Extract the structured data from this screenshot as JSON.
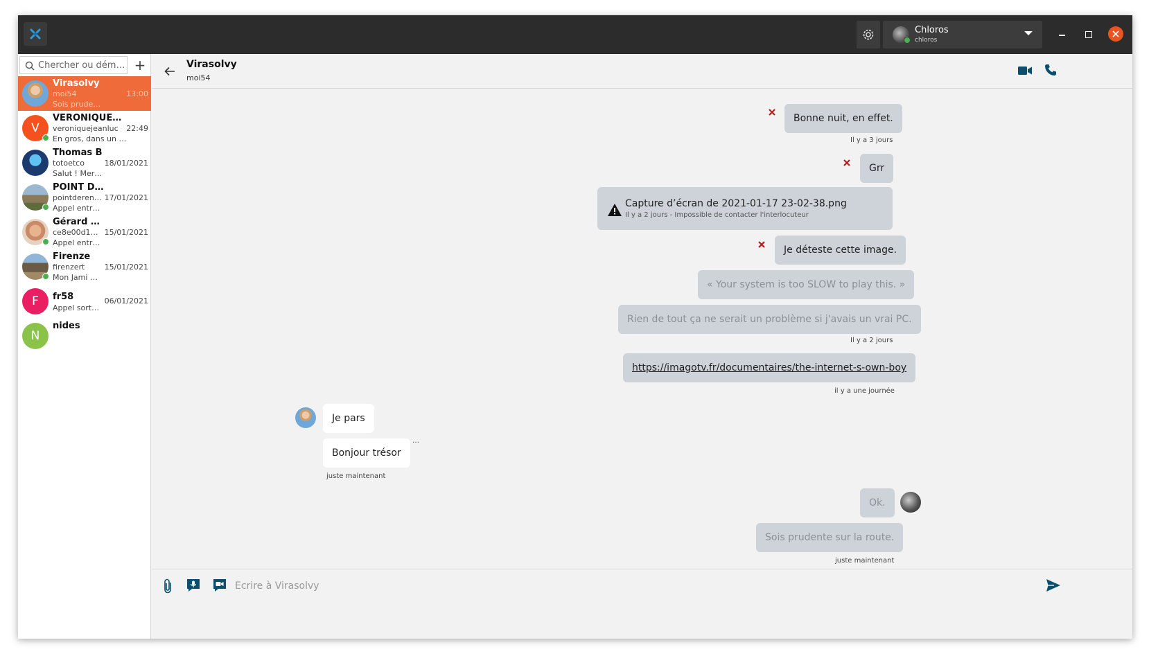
{
  "titlebar": {
    "account_name": "Chloros",
    "account_id": "chloros",
    "colors": {
      "bar": "#2c2c2c",
      "close": "#e95420",
      "accent": "#f06b3a",
      "online": "#4caf50"
    }
  },
  "sidebar": {
    "search_placeholder": "Chercher ou dém…",
    "add_label": "+",
    "conversations": [
      {
        "name": "Virasolvy",
        "id": "moi54",
        "time": "13:00",
        "preview": "Sois prudente sur…"
      },
      {
        "name": "VERONIQUE…",
        "id": "veroniquejeanluc",
        "time": "22:49",
        "preview": "En gros, dans un t…",
        "initial": "V"
      },
      {
        "name": "Thomas B",
        "id": "totoetco",
        "time": "18/01/2021",
        "preview": "Salut ! Mer…"
      },
      {
        "name": "POINT D…",
        "id": "pointderen…",
        "time": "17/01/2021",
        "preview": "Appel entr…"
      },
      {
        "name": "Gérard …",
        "id": "ce8e00d16…",
        "time": "15/01/2021",
        "preview": "Appel entr…"
      },
      {
        "name": "Firenze",
        "id": "firenzert",
        "time": "15/01/2021",
        "preview": "Mon Jami …"
      },
      {
        "name": "fr58",
        "id": "Appel sorta…",
        "time": "06/01/2021",
        "initial": "F"
      },
      {
        "name": "nides",
        "initial": "N"
      }
    ]
  },
  "chat": {
    "peer_name": "Virasolvy",
    "peer_id": "moi54",
    "messages": {
      "m1": "Bonne nuit, en effet.",
      "ts1": "Il y a 3 jours",
      "m2": "Grr",
      "file_name": "Capture d’écran de 2021-01-17 23-02-38.png",
      "file_status": "Il y a 2 jours - Impossible de contacter l'interlocuteur",
      "m3": "Je déteste cette image.",
      "m4": "« Your system is too SLOW to play this. »",
      "m5": "Rien de tout ça ne serait un problème si j'avais un vrai PC.",
      "ts2": "Il y a 2 jours",
      "m6": "https://imagotv.fr/documentaires/the-internet-s-own-boy",
      "ts3": "il y a une journée",
      "in1": "Je  pars",
      "in2": "Bonjour trésor",
      "typing": "…",
      "ts4": "juste maintenant",
      "m7": "Ok.",
      "m8": "Sois prudente sur la route.",
      "ts5": "juste maintenant"
    }
  },
  "composer": {
    "placeholder": "Écrire à Virasolvy"
  }
}
